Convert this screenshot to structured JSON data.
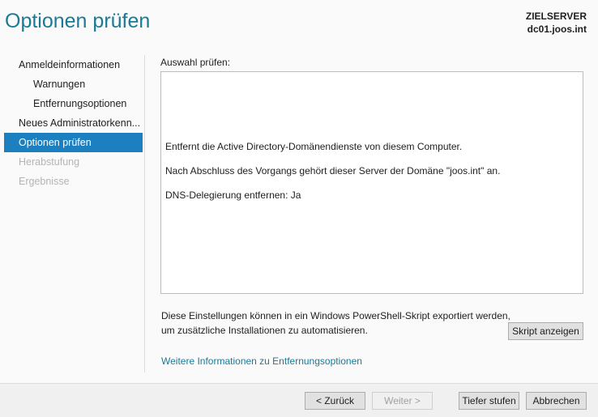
{
  "header": {
    "title": "Optionen prüfen",
    "server_label": "ZIELSERVER",
    "server_name": "dc01.joos.int"
  },
  "nav": [
    {
      "label": "Anmeldeinformationen",
      "state": "normal"
    },
    {
      "label": "Warnungen",
      "state": "sub"
    },
    {
      "label": "Entfernungsoptionen",
      "state": "sub"
    },
    {
      "label": "Neues Administratorkenn...",
      "state": "normal"
    },
    {
      "label": "Optionen prüfen",
      "state": "active"
    },
    {
      "label": "Herabstufung",
      "state": "disabled"
    },
    {
      "label": "Ergebnisse",
      "state": "disabled"
    }
  ],
  "main": {
    "review_label": "Auswahl prüfen:",
    "summary": [
      "Entfernt die Active Directory-Domänendienste von diesem Computer.",
      "Nach Abschluss des Vorgangs gehört dieser Server der Domäne \"joos.int\" an.",
      "DNS-Delegierung entfernen: Ja"
    ],
    "export_line1": "Diese Einstellungen können in ein Windows PowerShell-Skript exportiert werden,",
    "export_line2": "um zusätzliche Installationen zu automatisieren.",
    "view_script": "Skript anzeigen",
    "more_info_link": "Weitere Informationen zu Entfernungsoptionen"
  },
  "footer": {
    "back": "< Zurück",
    "next": "Weiter >",
    "demote": "Tiefer stufen",
    "cancel": "Abbrechen"
  }
}
